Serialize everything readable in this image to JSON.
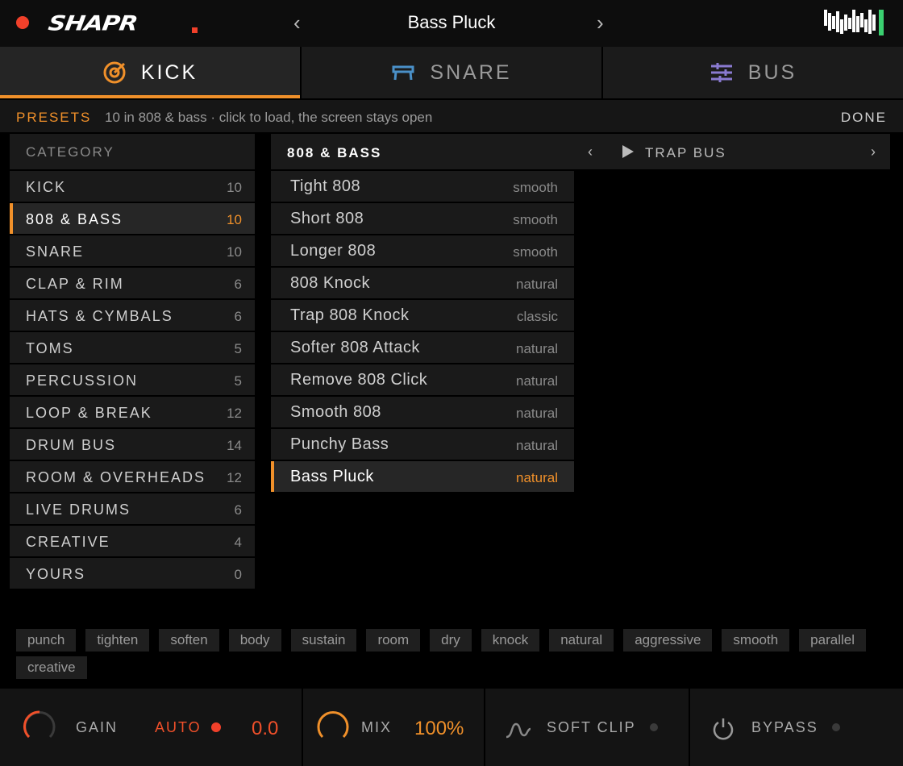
{
  "header": {
    "logo_text": "SHAPR",
    "preset_name": "Bass Pluck",
    "prev_symbol": "‹",
    "next_symbol": "›"
  },
  "tabs": [
    {
      "label": "KICK",
      "icon": "target-icon",
      "active": true
    },
    {
      "label": "SNARE",
      "icon": "snare-drum-icon",
      "active": false
    },
    {
      "label": "BUS",
      "icon": "sliders-icon",
      "active": false
    }
  ],
  "presets_bar": {
    "title": "PRESETS",
    "info": "10 in 808 & bass · click to load, the screen stays open",
    "done_label": "DONE"
  },
  "categories": {
    "header": "CATEGORY",
    "items": [
      {
        "label": "KICK",
        "count": "10"
      },
      {
        "label": "808 & BASS",
        "count": "10",
        "active": true
      },
      {
        "label": "SNARE",
        "count": "10"
      },
      {
        "label": "CLAP & RIM",
        "count": "6"
      },
      {
        "label": "HATS & CYMBALS",
        "count": "6"
      },
      {
        "label": "TOMS",
        "count": "5"
      },
      {
        "label": "PERCUSSION",
        "count": "5"
      },
      {
        "label": "LOOP & BREAK",
        "count": "12"
      },
      {
        "label": "DRUM BUS",
        "count": "14"
      },
      {
        "label": "ROOM & OVERHEADS",
        "count": "12"
      },
      {
        "label": "LIVE DRUMS",
        "count": "6"
      },
      {
        "label": "CREATIVE",
        "count": "4"
      },
      {
        "label": "YOURS",
        "count": "0"
      }
    ]
  },
  "preset_list": {
    "header_title": "808 & BASS",
    "prev_symbol": "‹",
    "next_symbol": "›",
    "next_category": "TRAP BUS",
    "items": [
      {
        "name": "Tight 808",
        "tag": "smooth"
      },
      {
        "name": "Short 808",
        "tag": "smooth"
      },
      {
        "name": "Longer 808",
        "tag": "smooth"
      },
      {
        "name": "808 Knock",
        "tag": "natural"
      },
      {
        "name": "Trap 808 Knock",
        "tag": "classic"
      },
      {
        "name": "Softer 808 Attack",
        "tag": "natural"
      },
      {
        "name": "Remove 808 Click",
        "tag": "natural"
      },
      {
        "name": "Smooth 808",
        "tag": "natural"
      },
      {
        "name": "Punchy Bass",
        "tag": "natural"
      },
      {
        "name": "Bass Pluck",
        "tag": "natural",
        "active": true
      }
    ]
  },
  "tag_chips": [
    "punch",
    "tighten",
    "soften",
    "body",
    "sustain",
    "room",
    "dry",
    "knock",
    "natural",
    "aggressive",
    "smooth",
    "parallel",
    "creative"
  ],
  "bottom": {
    "gain_label": "GAIN",
    "auto_label": "AUTO",
    "gain_value": "0.0",
    "mix_label": "MIX",
    "mix_value": "100%",
    "softclip_label": "SOFT CLIP",
    "bypass_label": "BYPASS"
  },
  "colors": {
    "accent": "#f0902a",
    "record_red": "#f0402a",
    "snare_icon": "#4a90c8",
    "bus_icon": "#8a7ad0",
    "brand_green": "#3ad070"
  }
}
